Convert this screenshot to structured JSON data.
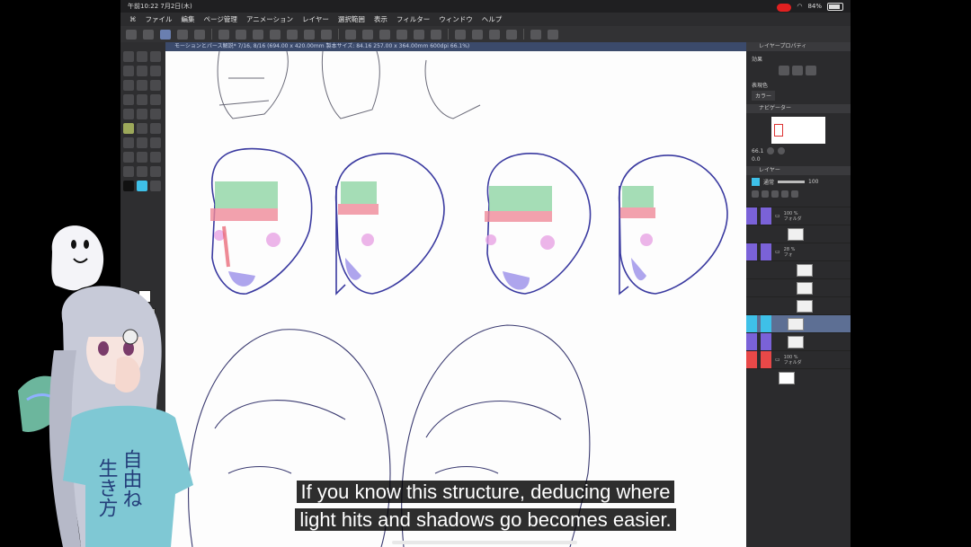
{
  "status": {
    "time": "午前10:22  7月2日(木)",
    "battery": "84%"
  },
  "menu": [
    "ファイル",
    "編集",
    "ページ管理",
    "アニメーション",
    "レイヤー",
    "選択範囲",
    "表示",
    "フィルター",
    "ウィンドウ",
    "ヘルプ"
  ],
  "document": {
    "title": "モーションとパース解説* 7/16, 8/16 (694.00 x 420.00mm 製本サイズ: 84.16 257.00 x 364.00mm 600dpi 66.1%)"
  },
  "panels": {
    "layer_property": "レイヤープロパティ",
    "effect": "効果",
    "display_color_label": "表現色",
    "display_color_value": "カラー",
    "navigator": "ナビゲーター",
    "zoom": "66.1",
    "rotation": "0.0",
    "layer": "レイヤー",
    "blend_mode": "通常",
    "opacity": "100"
  },
  "layers": [
    {
      "line1": "100 %",
      "line2": "フォルダ",
      "thumb": false
    },
    {
      "line1": "",
      "line2": "",
      "thumb": true
    },
    {
      "line1": "28 %",
      "line2": "フォ",
      "thumb": false
    },
    {
      "line1": "",
      "line2": "",
      "thumb": true
    },
    {
      "line1": "",
      "line2": "",
      "thumb": true
    },
    {
      "line1": "",
      "line2": "",
      "thumb": true
    },
    {
      "line1": "",
      "line2": "",
      "thumb": true,
      "selected": true
    },
    {
      "line1": "",
      "line2": "",
      "thumb": true
    },
    {
      "line1": "100 %",
      "line2": "フォルダ",
      "thumb": false
    },
    {
      "line1": "",
      "line2": "",
      "thumb": true
    }
  ],
  "subtitle": {
    "line1": "If you know this structure, deducing where",
    "line2": "light hits and shadows go becomes easier."
  },
  "shirt_text": {
    "line1": "自由ね",
    "line2": "生き方"
  },
  "colors": {
    "accent_blue": "#3ec0e8",
    "purple": "#7a62d8",
    "red": "#e84848",
    "face_green": "#8fd4a4",
    "face_pink": "#ef8a98",
    "cheek": "#e7a3e3",
    "chin": "#9a8ee8"
  }
}
